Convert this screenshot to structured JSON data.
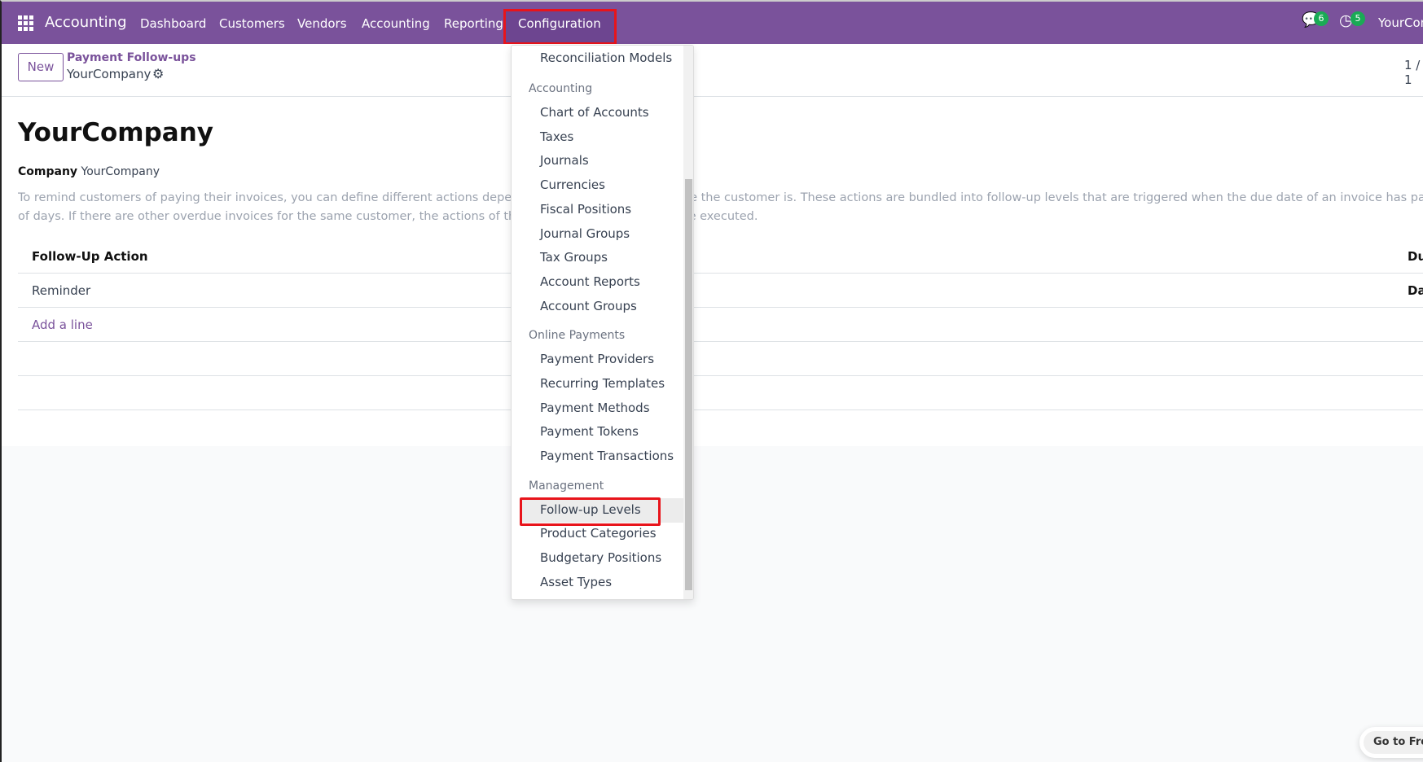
{
  "navbar": {
    "brand": "Accounting",
    "menu": [
      "Dashboard",
      "Customers",
      "Vendors",
      "Accounting",
      "Reporting",
      "Configuration"
    ],
    "messages_count": "6",
    "activities_count": "5",
    "company": "YourCompany"
  },
  "control_panel": {
    "new_label": "New",
    "breadcrumb_parent": "Payment Follow-ups",
    "breadcrumb_current": "YourCompany",
    "pager": "1 / 1"
  },
  "form": {
    "title": "YourCompany",
    "company_label": "Company",
    "company_value": "YourCompany",
    "description_line1": "To remind customers of paying their invoices, you can define different actions depending on how severely overdue the customer is. These actions are bundled into follow-up levels that are triggered when the due date of an invoice has passed a certain number",
    "description_line2": "of days. If there are other overdue invoices for the same customer, the actions of the most overdue invoice will be executed.",
    "table": {
      "col_action": "Follow-Up Action",
      "col_due": "Due Days",
      "rows": [
        "Reminder"
      ],
      "add_line": "Add a line"
    }
  },
  "dropdown": {
    "top_item": "Reconciliation Models",
    "sections": [
      {
        "title": "Accounting",
        "items": [
          "Chart of Accounts",
          "Taxes",
          "Journals",
          "Currencies",
          "Fiscal Positions",
          "Journal Groups",
          "Tax Groups",
          "Account Reports",
          "Account Groups"
        ]
      },
      {
        "title": "Online Payments",
        "items": [
          "Payment Providers",
          "Recurring Templates",
          "Payment Methods",
          "Payment Tokens",
          "Payment Transactions"
        ]
      },
      {
        "title": "Management",
        "items": [
          "Follow-up Levels",
          "Product Categories",
          "Budgetary Positions",
          "Asset Types"
        ]
      }
    ]
  },
  "footer": {
    "go_to_frontend": "Go to Frontend"
  },
  "colors": {
    "brand": "#7a529b",
    "highlight": "#e8141b",
    "badge": "#1aaa55"
  }
}
